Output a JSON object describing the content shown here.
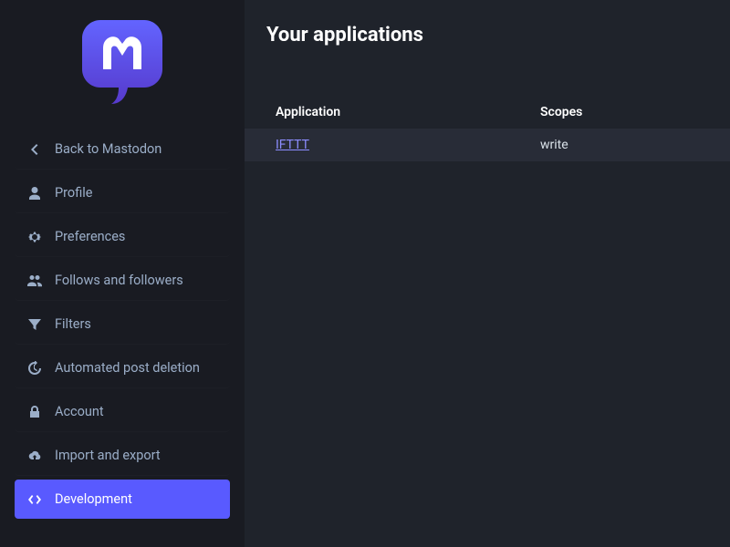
{
  "sidebar": {
    "items": [
      {
        "label": "Back to Mastodon"
      },
      {
        "label": "Profile"
      },
      {
        "label": "Preferences"
      },
      {
        "label": "Follows and followers"
      },
      {
        "label": "Filters"
      },
      {
        "label": "Automated post deletion"
      },
      {
        "label": "Account"
      },
      {
        "label": "Import and export"
      },
      {
        "label": "Development"
      }
    ]
  },
  "page": {
    "title": "Your applications",
    "table": {
      "headers": {
        "application": "Application",
        "scopes": "Scopes"
      },
      "rows": [
        {
          "application": "IFTTT",
          "scopes": "write"
        }
      ]
    }
  },
  "colors": {
    "accent": "#595aff",
    "link": "#8c8dff",
    "bg_sidebar": "#191b22",
    "bg_main": "#1f232b",
    "bg_row": "#282c37"
  }
}
